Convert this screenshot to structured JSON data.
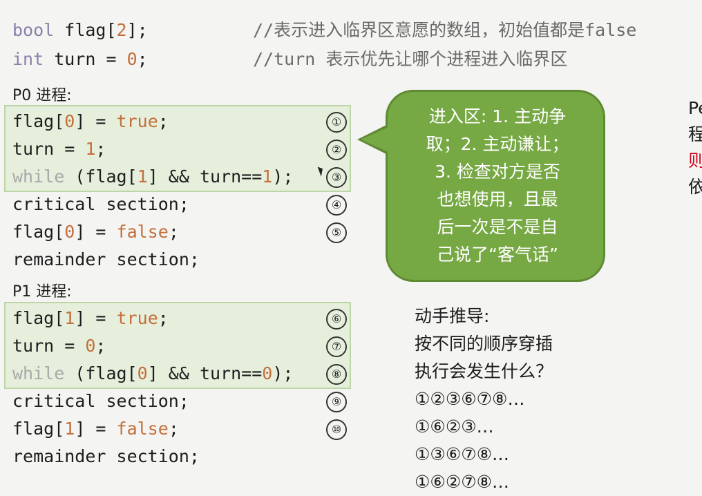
{
  "header": {
    "line1": {
      "type": "bool",
      "rest": " flag[",
      "num": "2",
      "end": "];",
      "comment": "//表示进入临界区意愿的数组，初始值都是false"
    },
    "line2": {
      "type": "int",
      "rest": " turn = ",
      "num": "0",
      "end": ";",
      "comment": "//turn 表示优先让哪个进程进入临界区"
    }
  },
  "p0": {
    "label": "P0 进程:",
    "lines": [
      {
        "a": "flag[",
        "n": "0",
        "b": "] = ",
        "v": "true",
        "c": ";",
        "mark": "①"
      },
      {
        "a": "turn = ",
        "n": "1",
        "c": ";",
        "mark": "②"
      },
      {
        "w": "while",
        "a": " (flag[",
        "n": "1",
        "b": "] && turn==",
        "n2": "1",
        "c": ");",
        "mark": "③"
      },
      {
        "a": "critical section;",
        "mark": "④"
      },
      {
        "a": "flag[",
        "n": "0",
        "b": "] = ",
        "v": "false",
        "c": ";",
        "mark": "⑤"
      },
      {
        "a": "remainder section;"
      }
    ]
  },
  "p1": {
    "label": "P1 进程:",
    "lines": [
      {
        "a": "flag[",
        "n": "1",
        "b": "] = ",
        "v": "true",
        "c": ";",
        "mark": "⑥"
      },
      {
        "a": "turn = ",
        "n": "0",
        "c": ";",
        "mark": "⑦"
      },
      {
        "w": "while",
        "a": " (flag[",
        "n": "0",
        "b": "] && turn==",
        "n2": "0",
        "c": ");",
        "mark": "⑧"
      },
      {
        "a": "critical section;",
        "mark": "⑨"
      },
      {
        "a": "flag[",
        "n": "1",
        "b": "] = ",
        "v": "false",
        "c": ";",
        "mark": "⑩"
      },
      {
        "a": "remainder section;"
      }
    ]
  },
  "bubble": {
    "lines": [
      "进入区: 1. 主动争",
      "取；2. 主动谦让；",
      "3. 检查对方是否",
      "也想使用，且最",
      "后一次是不是自",
      "己说了“客气话”"
    ]
  },
  "derivation": {
    "lines": [
      "动手推导:",
      "按不同的顺序穿插",
      "执行会发生什么？",
      "①②③⑥⑦⑧…",
      "①⑥②③…",
      "①③⑥⑦⑧…",
      "①⑥②⑦⑧…"
    ]
  },
  "edge": {
    "lines": [
      "Pe",
      "程",
      "则",
      "依"
    ],
    "colors": {
      "third": "#d0021b"
    }
  },
  "colors": {
    "bubble": "#76a843",
    "highlight": "#e6efdc",
    "number": "#c46f3b",
    "keyword": "#8b7fa8"
  }
}
